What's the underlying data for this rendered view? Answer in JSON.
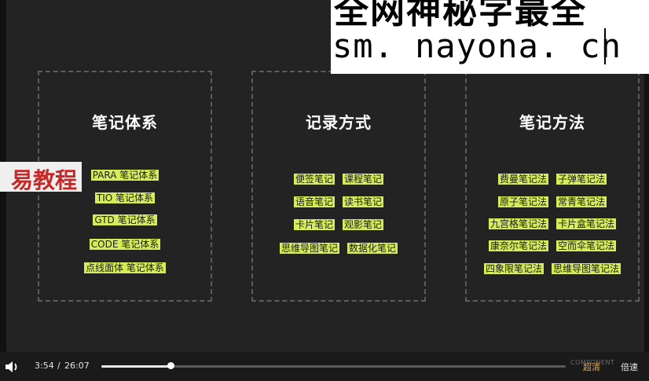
{
  "watermark": {
    "line1": "全网神秘字最全",
    "line2": "sm. nayona. cn"
  },
  "side_banner": "易教程",
  "panels": [
    {
      "title": "笔记体系",
      "items": [
        "PARA 笔记体系",
        "TIO 笔记体系",
        "GTD 笔记体系",
        "CODE 笔记体系",
        "点线面体 笔记体系"
      ]
    },
    {
      "title": "记录方式",
      "rows": [
        [
          "便签笔记",
          "课程笔记"
        ],
        [
          "语音笔记",
          "读书笔记"
        ],
        [
          "卡片笔记",
          "观影笔记"
        ],
        [
          "思维导图笔记",
          "数据化笔记"
        ]
      ]
    },
    {
      "title": "笔记方法",
      "rows": [
        [
          "费曼笔记法",
          "子弹笔记法"
        ],
        [
          "原子笔记法",
          "常青笔记法"
        ],
        [
          "九宫格笔记法",
          "卡片盒笔记法"
        ],
        [
          "康奈尔笔记法",
          "空而伞笔记法"
        ],
        [
          "四象限笔记法",
          "思维导图笔记法"
        ]
      ]
    }
  ],
  "player": {
    "current_time": "3:54",
    "separator": "/",
    "total_time": "26:07",
    "progress_fraction": 0.149,
    "brand_text": "COMPONENT",
    "quality_label": "超清",
    "speed_label": "倍速"
  },
  "colors": {
    "highlight": "#d7ec5b",
    "quality": "#e0a64a"
  },
  "icons": [
    "volume-icon"
  ]
}
